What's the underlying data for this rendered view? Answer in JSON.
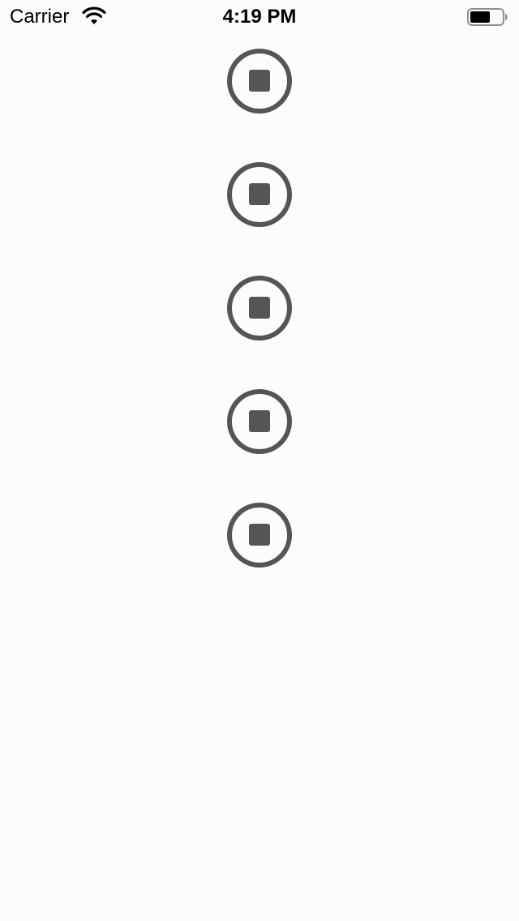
{
  "status_bar": {
    "carrier": "Carrier",
    "time": "4:19 PM",
    "wifi_icon": "wifi-icon",
    "battery_icon": "battery-icon"
  },
  "stop_buttons": [
    {
      "icon": "stop-circle-icon"
    },
    {
      "icon": "stop-circle-icon"
    },
    {
      "icon": "stop-circle-icon"
    },
    {
      "icon": "stop-circle-icon"
    },
    {
      "icon": "stop-circle-icon"
    }
  ],
  "colors": {
    "background": "#fcfcfe",
    "icon": "#555555",
    "text": "#000000"
  }
}
